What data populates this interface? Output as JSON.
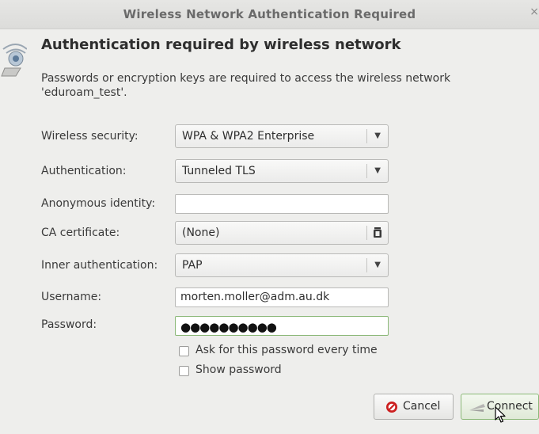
{
  "window": {
    "title": "Wireless Network Authentication Required",
    "close_glyph": "×"
  },
  "dialog": {
    "heading": "Authentication required by wireless network",
    "description_line1": "Passwords or encryption keys are required to access the wireless network",
    "description_line2": "'eduroam_test'."
  },
  "form": {
    "wireless_security": {
      "label": "Wireless security:",
      "value": "WPA & WPA2 Enterprise"
    },
    "authentication": {
      "label": "Authentication:",
      "value": "Tunneled TLS"
    },
    "anonymous_identity": {
      "label": "Anonymous identity:",
      "value": ""
    },
    "ca_certificate": {
      "label": "CA certificate:",
      "value": "(None)"
    },
    "inner_authentication": {
      "label": "Inner authentication:",
      "value": "PAP"
    },
    "username": {
      "label": "Username:",
      "value": "morten.moller@adm.au.dk"
    },
    "password": {
      "label": "Password:",
      "masked": "●●●●●●●●●●"
    },
    "ask_password": {
      "label": "Ask for this password every time",
      "checked": false
    },
    "show_password": {
      "label": "Show password",
      "checked": false
    }
  },
  "buttons": {
    "cancel": "Cancel",
    "connect": "Connect"
  },
  "colors": {
    "cancel_icon": "#cc1f1f",
    "focus_border": "#8bb878"
  },
  "icons": {
    "network": "wireless-network-icon",
    "file_chooser": "file-chooser-icon",
    "cancel": "cancel-icon",
    "connect": "connect-icon",
    "cursor": "mouse-cursor"
  }
}
